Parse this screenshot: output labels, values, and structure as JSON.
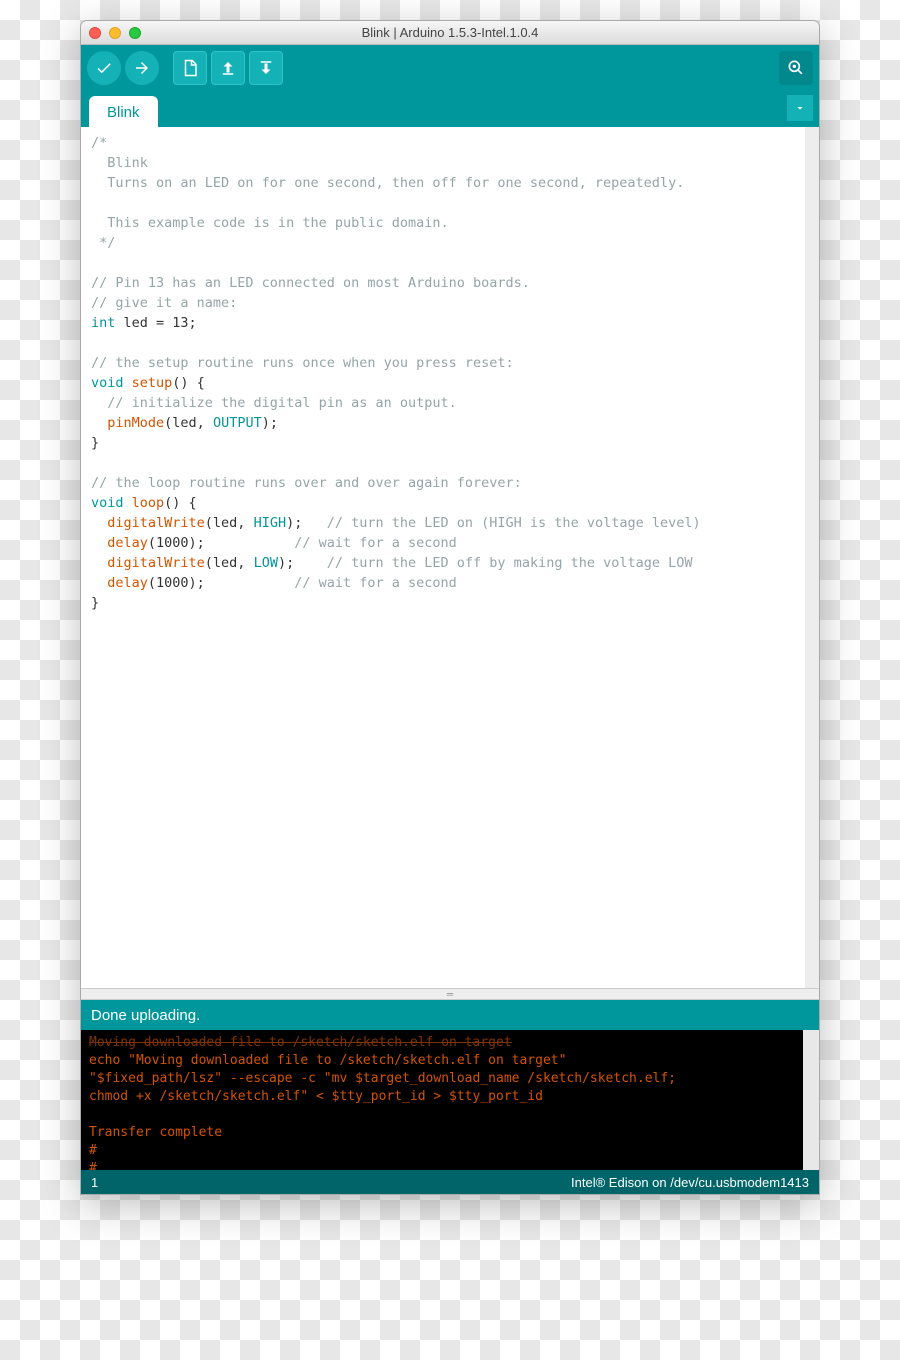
{
  "window": {
    "title": "Blink | Arduino 1.5.3-Intel.1.0.4"
  },
  "tab": {
    "name": "Blink"
  },
  "status": {
    "message": "Done uploading."
  },
  "footer": {
    "line": "1",
    "board": "Intel® Edison on /dev/cu.usbmodem1413"
  },
  "code": {
    "c1": "/*",
    "c2": "  Blink",
    "c3": "  Turns on an LED on for one second, then off for one second, repeatedly.",
    "c4": "",
    "c5": "  This example code is in the public domain.",
    "c6": " */",
    "c7": "// Pin 13 has an LED connected on most Arduino boards.",
    "c8": "// give it a name:",
    "l9_type": "int",
    "l9_rest": " led = 13;",
    "c10": "// the setup routine runs once when you press reset:",
    "l11_type": "void",
    "l11_fn": " setup",
    "l11_rest": "() {",
    "c12": "  // initialize the digital pin as an output.",
    "l13_fn": "  pinMode",
    "l13_mid": "(led, ",
    "l13_const": "OUTPUT",
    "l13_end": ");",
    "l14": "}",
    "c15": "// the loop routine runs over and over again forever:",
    "l16_type": "void",
    "l16_fn": " loop",
    "l16_rest": "() {",
    "l17_fn": "  digitalWrite",
    "l17_mid": "(led, ",
    "l17_const": "HIGH",
    "l17_end": ");   ",
    "l17_cm": "// turn the LED on (HIGH is the voltage level)",
    "l18_fn": "  delay",
    "l18_mid": "(1000);           ",
    "l18_cm": "// wait for a second",
    "l19_fn": "  digitalWrite",
    "l19_mid": "(led, ",
    "l19_const": "LOW",
    "l19_end": ");    ",
    "l19_cm": "// turn the LED off by making the voltage LOW",
    "l20_fn": "  delay",
    "l20_mid": "(1000);           ",
    "l20_cm": "// wait for a second",
    "l21": "}"
  },
  "console": {
    "l1": "Moving downloaded file to /sketch/sketch.elf on target",
    "l2": "echo \"Moving downloaded file to /sketch/sketch.elf on target\"",
    "l3": "\"$fixed_path/lsz\" --escape -c \"mv $target_download_name /sketch/sketch.elf;",
    "l4": "chmod +x /sketch/sketch.elf\" < $tty_port_id > $tty_port_id",
    "l5": "",
    "l6": "Transfer complete",
    "l7": "#",
    "l8": "#"
  }
}
